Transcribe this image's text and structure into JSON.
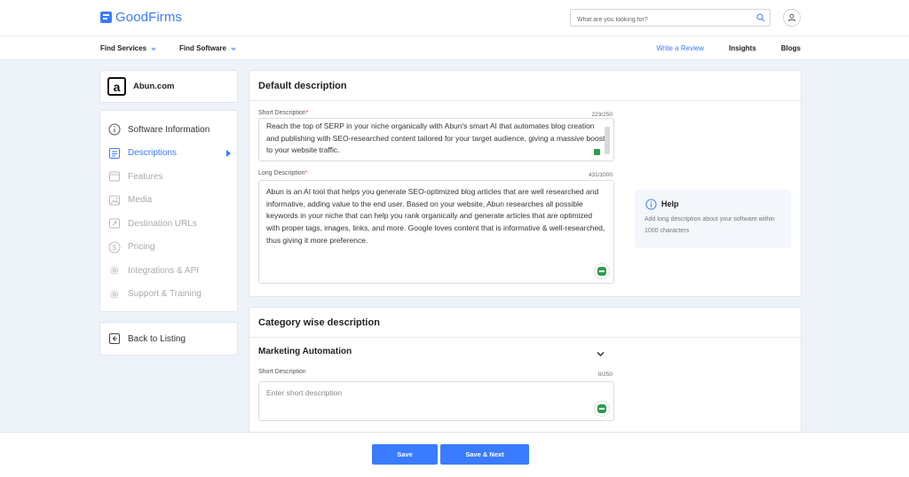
{
  "header": {
    "brand": "GoodFirms",
    "search_placeholder": "What are you looking for?",
    "icons": {
      "search": "search-icon",
      "user": "user-icon"
    }
  },
  "nav": {
    "left": [
      {
        "label": "Find Services"
      },
      {
        "label": "Find Software"
      }
    ],
    "right": [
      {
        "label": "Write a Review"
      },
      {
        "label": "Insights"
      },
      {
        "label": "Blogs"
      }
    ]
  },
  "company": {
    "logo_letter": "a",
    "name": "Abun.com"
  },
  "sidebar": {
    "items": [
      {
        "label": "Software Information",
        "icon": "info-icon",
        "state": "done"
      },
      {
        "label": "Descriptions",
        "icon": "document-icon",
        "state": "active"
      },
      {
        "label": "Features",
        "icon": "features-icon",
        "state": "inactive"
      },
      {
        "label": "Media",
        "icon": "media-icon",
        "state": "inactive"
      },
      {
        "label": "Destination URLs",
        "icon": "link-icon",
        "state": "inactive"
      },
      {
        "label": "Pricing",
        "icon": "dollar-icon",
        "state": "inactive"
      },
      {
        "label": "Integrations & API",
        "icon": "gear-icon",
        "state": "inactive"
      },
      {
        "label": "Support & Training",
        "icon": "gear-icon",
        "state": "inactive"
      }
    ],
    "back_label": "Back to Listing"
  },
  "default_description": {
    "title": "Default description",
    "short_label": "Short Description",
    "short_counter": "223/250",
    "short_value": "Reach the top of SERP in your niche organically with Abun's smart AI that automates blog creation and publishing with SEO-researched content tailored for your target audience, giving a massive boost to your website traffic.",
    "long_label": "Long Description",
    "long_counter": "431/1000",
    "long_value": "Abun is an AI tool that helps you generate SEO-optimized blog articles that are well researched and informative, adding value to the end user. Based on your website, Abun researches all possible keywords in your niche that can help you rank organically and generate articles that are optimized with proper tags, images, links, and more. Google loves content that is informative & well-researched, thus giving it more preference."
  },
  "help": {
    "title": "Help",
    "text": "Add long description about your software within 1000 characters"
  },
  "category_description": {
    "title": "Category wise description",
    "category_name": "Marketing Automation",
    "short_label": "Short Description",
    "short_counter": "0/250",
    "short_placeholder": "Enter short description"
  },
  "footer": {
    "save": "Save",
    "save_next": "Save & Next"
  },
  "colors": {
    "accent": "#3a7bff",
    "required": "#e53935",
    "extension": "#2e9c4e"
  }
}
